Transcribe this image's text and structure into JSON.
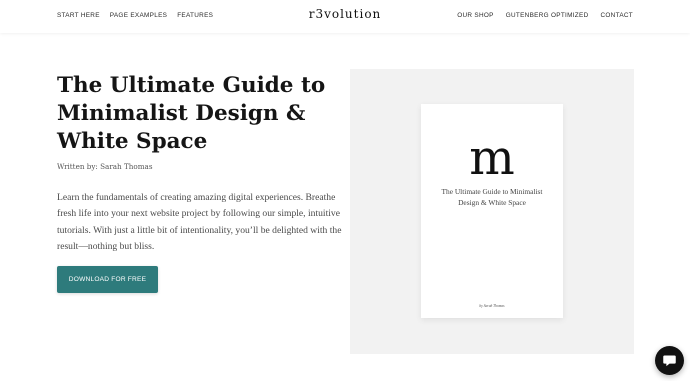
{
  "nav": {
    "left": [
      "START HERE",
      "PAGE EXAMPLES",
      "FEATURES"
    ],
    "logo": "r3volution",
    "right": [
      "OUR SHOP",
      "GUTENBERG OPTIMIZED",
      "CONTACT"
    ]
  },
  "hero": {
    "title": "The Ultimate Guide to Minimalist Design & White Space",
    "byline_prefix": "Written by:",
    "byline_author": "Sarah Thomas",
    "description": "Learn the fundamentals of creating amazing digital experiences. Breathe fresh life into your next website project by following our simple, intuitive tutorials. With just a little bit of intentionality, you’ll be delighted with the result—nothing but bliss.",
    "cta_label": "DOWNLOAD FOR FREE",
    "cta_color": "#2e7b7c"
  },
  "book": {
    "initial": "m",
    "title": "The Ultimate Guide to Minimalist Design & White Space",
    "author": "by Sarah Thomas"
  },
  "chat": {
    "icon": "chat-bubble-icon"
  }
}
